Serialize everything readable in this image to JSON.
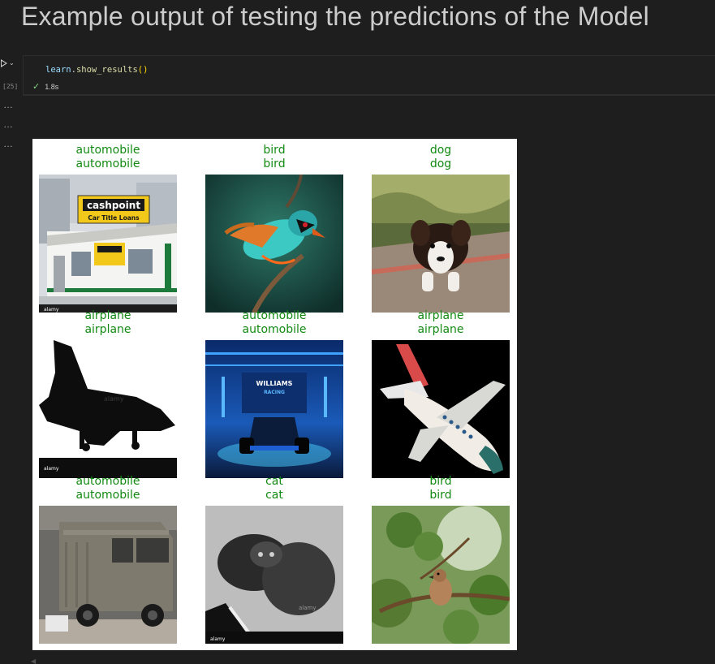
{
  "heading": "Example output of testing the predictions of the Model",
  "cell": {
    "code_object": "learn",
    "code_method": "show_results",
    "code_parens": "()",
    "exec_count": "[25]",
    "duration": "1.8s"
  },
  "output_markers": [
    "…",
    "…",
    "…"
  ],
  "results": [
    {
      "actual": "automobile",
      "predicted": "automobile",
      "image": "cashpoint-store-building"
    },
    {
      "actual": "bird",
      "predicted": "bird",
      "image": "turquoise-bird-on-branch"
    },
    {
      "actual": "dog",
      "predicted": "dog",
      "image": "puppy-on-path"
    },
    {
      "actual": "airplane",
      "predicted": "airplane",
      "image": "black-jet-silhouette"
    },
    {
      "actual": "automobile",
      "predicted": "automobile",
      "image": "williams-racing-car"
    },
    {
      "actual": "airplane",
      "predicted": "airplane",
      "image": "cartoon-airplane"
    },
    {
      "actual": "automobile",
      "predicted": "automobile",
      "image": "vintage-van"
    },
    {
      "actual": "cat",
      "predicted": "cat",
      "image": "grayscale-cats"
    },
    {
      "actual": "bird",
      "predicted": "bird",
      "image": "sparrow-in-tree"
    }
  ],
  "colors": {
    "label_correct": "#138a13",
    "background": "#1e1e1e",
    "check": "#89d185"
  },
  "image_watermarks": {
    "alamy": "alamy",
    "sign_line1": "cashpoint",
    "sign_line2": "Car Title Loans",
    "williams_line1": "WILLIAMS",
    "williams_line2": "RACING"
  }
}
